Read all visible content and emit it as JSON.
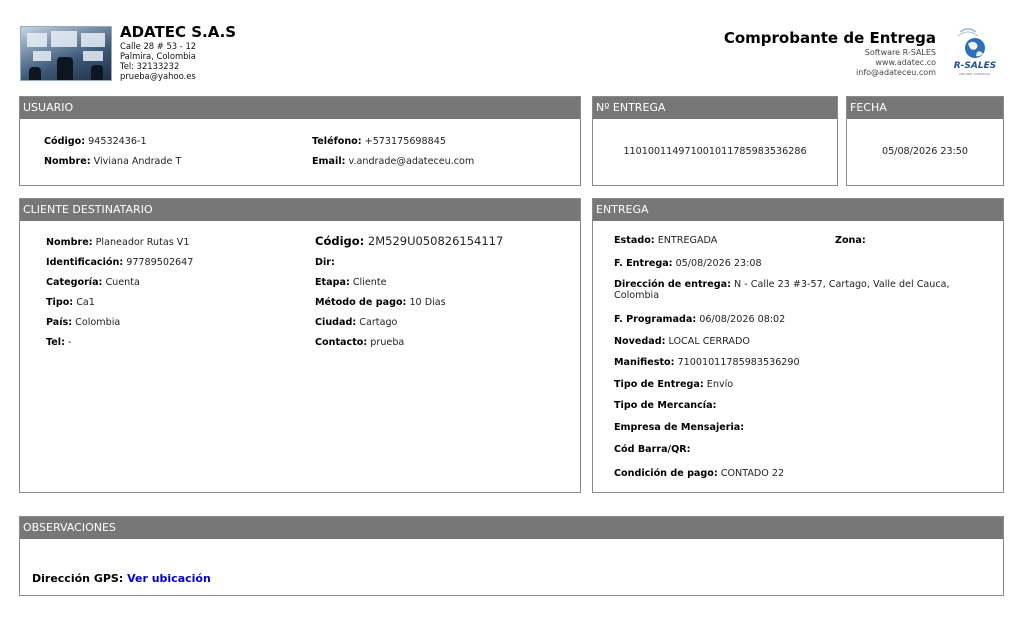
{
  "company": {
    "name": "ADATEC S.A.S",
    "address": "Calle 28 # 53 - 12",
    "city": "Palmira, Colombia",
    "phone": "Tel: 32133232",
    "email": "prueba@yahoo.es"
  },
  "document": {
    "title": "Comprobante de Entrega",
    "software": "Software R-SALES",
    "website": "www.adatec.co",
    "contact_email": "info@adateceu.com",
    "brand_logo_text": "R-SALES",
    "brand_tagline": "ERP RED COMERCIAL"
  },
  "usuario": {
    "header": "USUARIO",
    "codigo_label": "Código:",
    "codigo": "94532436-1",
    "nombre_label": "Nombre:",
    "nombre": "Viviana Andrade T",
    "telefono_label": "Teléfono:",
    "telefono": "+573175698845",
    "email_label": "Email:",
    "email": "v.andrade@adateceu.com"
  },
  "entrega_num": {
    "header": "Nº ENTREGA",
    "value": "1101001149710010117859835362​86"
  },
  "fecha": {
    "header": "FECHA",
    "value": "05/08/2026 23:50"
  },
  "cliente": {
    "header": "CLIENTE DESTINATARIO",
    "nombre_label": "Nombre:",
    "nombre": "Planeador Rutas V1",
    "identificacion_label": "Identificación:",
    "identificacion": "97789502647",
    "categoria_label": "Categoría:",
    "categoria": "Cuenta",
    "tipo_label": "Tipo:",
    "tipo": "Ca1",
    "pais_label": "País:",
    "pais": "Colombia",
    "tel_label": "Tel:",
    "tel": "-",
    "codigo_label": "Código:",
    "codigo": "2M529U050826154117",
    "dir_label": "Dir:",
    "dir": "",
    "etapa_label": "Etapa:",
    "etapa": "Cliente",
    "metodo_label": "Método de pago:",
    "metodo": "10 Dias",
    "ciudad_label": "Ciudad:",
    "ciudad": "Cartago",
    "contacto_label": "Contacto:",
    "contacto": "prueba"
  },
  "entrega": {
    "header": "ENTREGA",
    "estado_label": "Estado:",
    "estado": "ENTREGADA",
    "zona_label": "Zona:",
    "zona": "",
    "f_entrega_label": "F. Entrega:",
    "f_entrega": "05/08/2026 23:08",
    "direccion_label": "Dirección de entrega:",
    "direccion": "N - Calle 23 #3-57, Cartago, Valle del Cauca, Colombia",
    "f_programada_label": "F. Programada:",
    "f_programada": "06/08/2026 08:02",
    "novedad_label": "Novedad:",
    "novedad": "LOCAL CERRADO",
    "manifiesto_label": "Manifiesto:",
    "manifiesto": "71001011785983536290",
    "tipo_entrega_label": "Tipo de Entrega:",
    "tipo_entrega": "Envío",
    "tipo_mercancia_label": "Tipo de Mercancía:",
    "tipo_mercancia": "",
    "empresa_label": "Empresa de Mensajeria:",
    "empresa": "",
    "cod_barra_label": "Cód Barra/QR:",
    "cod_barra": "",
    "condicion_label": "Condición de pago:",
    "condicion": "CONTADO 22"
  },
  "observaciones": {
    "header": "OBSERVACIONES",
    "gps_label": "Dirección GPS:",
    "gps_link": "Ver ubicación"
  },
  "colors": {
    "panel_header_bg": "#777777",
    "panel_border": "#8a8a8a",
    "link": "#0000cc"
  }
}
